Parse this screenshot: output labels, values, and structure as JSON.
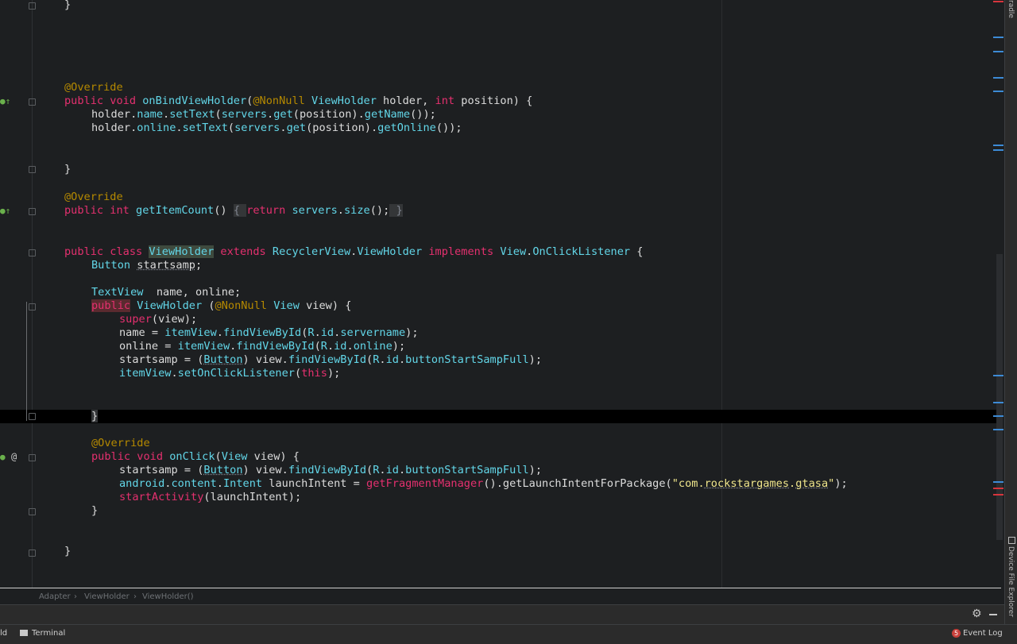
{
  "colors": {
    "keyword": "#e5306f",
    "type": "#62d6e8",
    "annotation": "#b58900",
    "string": "#f0e68c",
    "text": "#dcdcdc",
    "background": "#1d1f21"
  },
  "code": {
    "l0": "}",
    "l1": "@Override",
    "l2": [
      "public void ",
      "onBindViewHolder",
      "(",
      "@NonNull",
      " ",
      "ViewHolder",
      " holder, ",
      "int",
      " position) {"
    ],
    "l3": [
      "holder.",
      "name",
      ".",
      "setText",
      "(",
      "servers",
      ".",
      "get",
      "(position).",
      "getName",
      "());"
    ],
    "l4": [
      "holder.",
      "online",
      ".",
      "setText",
      "(",
      "servers",
      ".",
      "get",
      "(position).",
      "getOnline",
      "());"
    ],
    "l5": "}",
    "l6": "@Override",
    "l7": [
      "public int ",
      "getItemCount",
      "() ",
      "{ ",
      "return ",
      "servers",
      ".",
      "size",
      "();",
      " }"
    ],
    "l8": [
      "public class ",
      "ViewHolder",
      " extends ",
      "RecyclerView",
      ".",
      "ViewHolder",
      " implements ",
      "View",
      ".",
      "OnClickListener",
      " {"
    ],
    "l9": [
      "Button",
      " ",
      "startsamp",
      ";"
    ],
    "l10": [
      "TextView",
      "  name, online;"
    ],
    "l11": [
      "public",
      " ",
      "ViewHolder",
      " (",
      "@NonNull",
      " ",
      "View",
      " view) {"
    ],
    "l12": [
      "super",
      "(view);"
    ],
    "l13": [
      "name = ",
      "itemView",
      ".",
      "findViewById",
      "(",
      "R",
      ".",
      "id",
      ".",
      "servername",
      ");"
    ],
    "l14": [
      "online = ",
      "itemView",
      ".",
      "findViewById",
      "(",
      "R",
      ".",
      "id",
      ".",
      "online",
      ");"
    ],
    "l15": [
      "startsamp = (",
      "Button",
      ") view.",
      "findViewById",
      "(",
      "R",
      ".",
      "id",
      ".",
      "buttonStartSampFull",
      ");"
    ],
    "l16": [
      "itemView",
      ".",
      "setOnClickListener",
      "(",
      "this",
      ");"
    ],
    "l17": "}",
    "l18": "@Override",
    "l19": [
      "public void ",
      "onClick",
      "(",
      "View",
      " view) {"
    ],
    "l20": [
      "startsamp = (",
      "Button",
      ") view.",
      "findViewById",
      "(",
      "R",
      ".",
      "id",
      ".",
      "buttonStartSampFull",
      ");"
    ],
    "l21": [
      "android",
      ".",
      "content",
      ".",
      "Intent",
      " launchIntent = ",
      "getFragmentManager",
      "().getLaunchIntentForPackage(",
      "\"com.",
      "rockstargames",
      ".",
      "gtasa",
      "\"",
      ");"
    ],
    "l22": [
      "startActivity",
      "(launchIntent);"
    ],
    "l23": "}",
    "l24": "}"
  },
  "gutter": {
    "override_icon": "●↑",
    "implements_icon": "●↑",
    "at_icon": "@"
  },
  "breadcrumb": {
    "items": [
      "Adapter",
      "ViewHolder",
      "ViewHolder()"
    ],
    "separator": "›"
  },
  "right_strip": {
    "top_label": "radle",
    "bottom_label": "Device File Explorer"
  },
  "statusbar": {
    "left_cut": "ld",
    "terminal": "Terminal",
    "event_count": "5",
    "event_log": "Event Log"
  }
}
